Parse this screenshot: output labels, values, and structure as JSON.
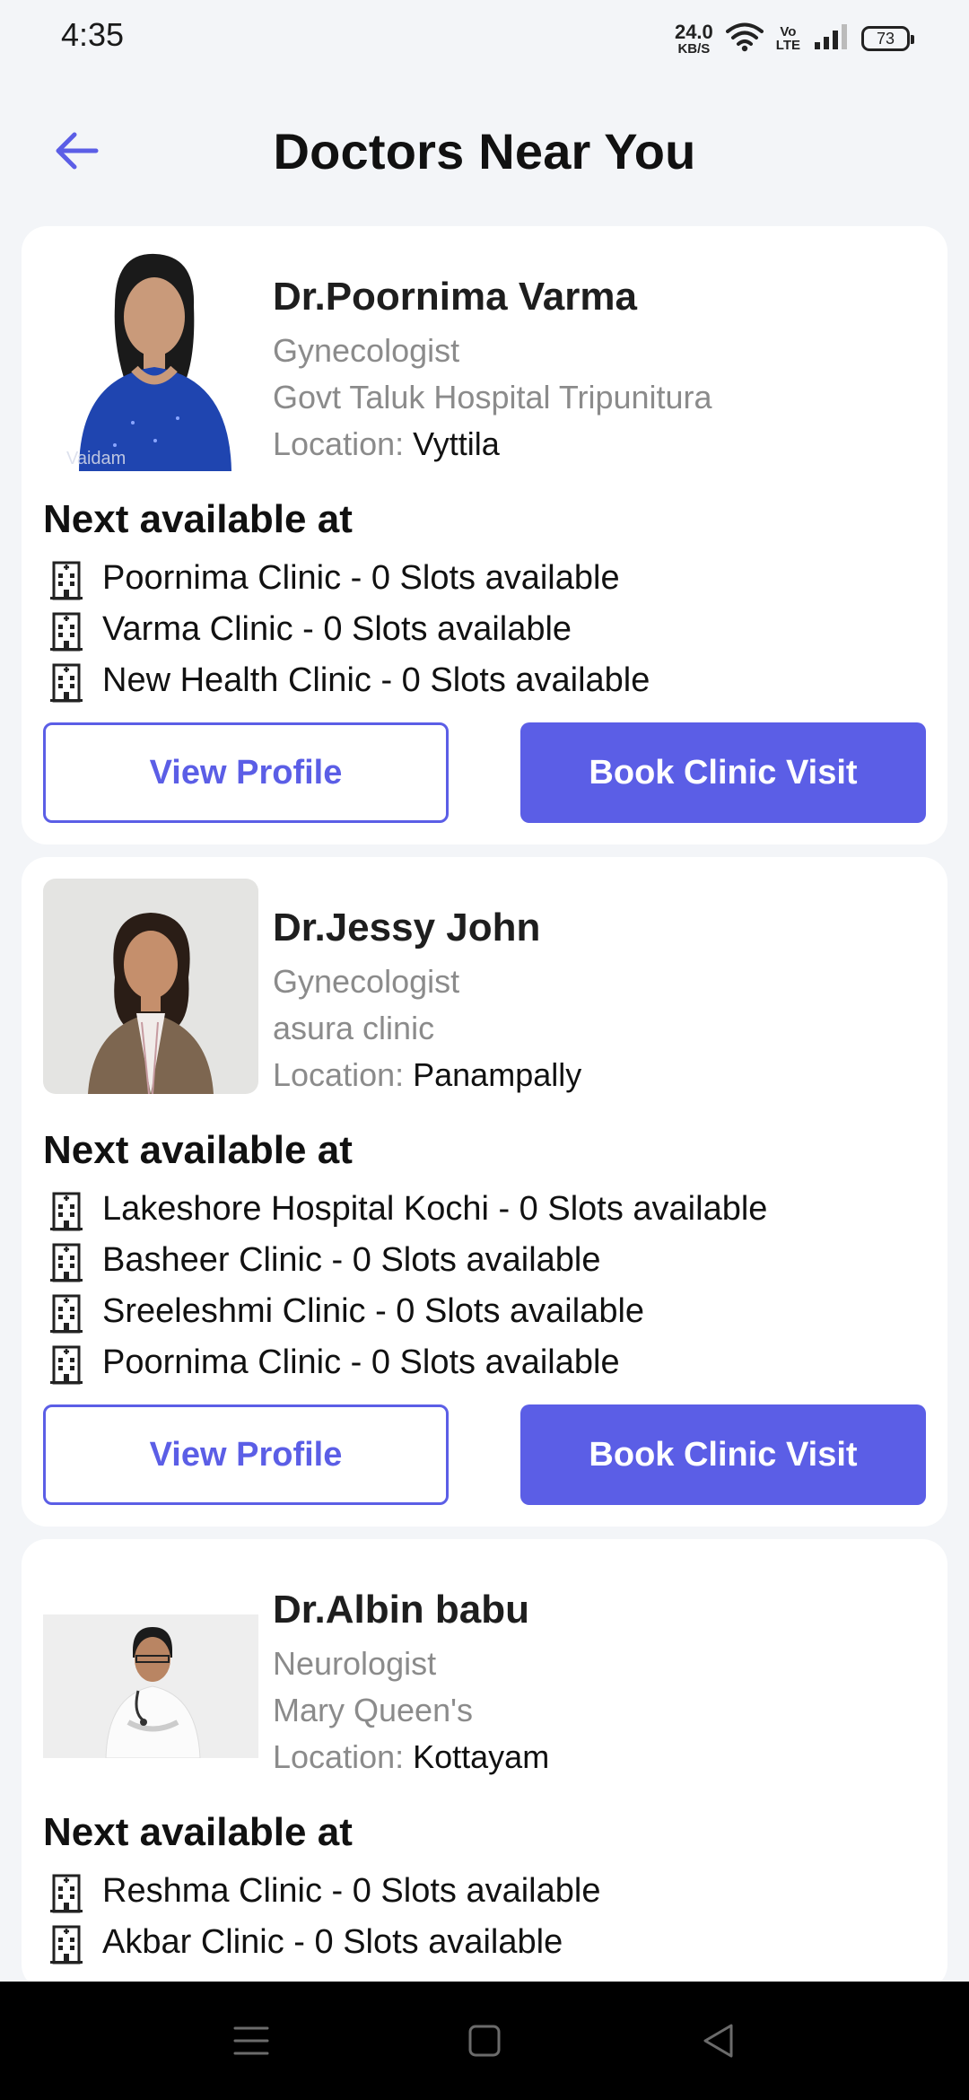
{
  "status_bar": {
    "time": "4:35",
    "net_speed_value": "24.0",
    "net_speed_unit": "KB/S",
    "volte_top": "Vo",
    "volte_bottom": "LTE",
    "battery": "73"
  },
  "header": {
    "title": "Doctors Near You",
    "back_icon": "arrow-left-icon",
    "accent_color": "#5b5ee6"
  },
  "common": {
    "next_available_label": "Next available at",
    "location_label": "Location: ",
    "view_profile_label": "View Profile",
    "book_visit_label": "Book Clinic Visit",
    "slot_icon": "hospital-building-icon"
  },
  "doctors": [
    {
      "name": "Dr.Poornima Varma",
      "specialty": "Gynecologist",
      "hospital": "Govt Taluk Hospital Tripunitura",
      "location": "Vyttila",
      "photo_watermark": "Vaidam",
      "slots": [
        "Poornima Clinic - 0 Slots available",
        "Varma Clinic - 0 Slots available",
        "New Health Clinic - 0 Slots available"
      ]
    },
    {
      "name": "Dr.Jessy John",
      "specialty": "Gynecologist",
      "hospital": "asura clinic",
      "location": "Panampally",
      "slots": [
        "Lakeshore Hospital Kochi - 0 Slots available",
        "Basheer Clinic - 0 Slots available",
        "Sreeleshmi Clinic - 0 Slots available",
        "Poornima Clinic - 0 Slots available"
      ]
    },
    {
      "name": "Dr.Albin babu",
      "specialty": "Neurologist",
      "hospital": "Mary Queen's",
      "location": "Kottayam",
      "slots": [
        "Reshma Clinic - 0 Slots available",
        "Akbar Clinic - 0 Slots available"
      ]
    }
  ],
  "nav_bar": {
    "menu_icon": "menu-icon",
    "home_icon": "square-home-icon",
    "back_icon": "triangle-back-icon"
  }
}
